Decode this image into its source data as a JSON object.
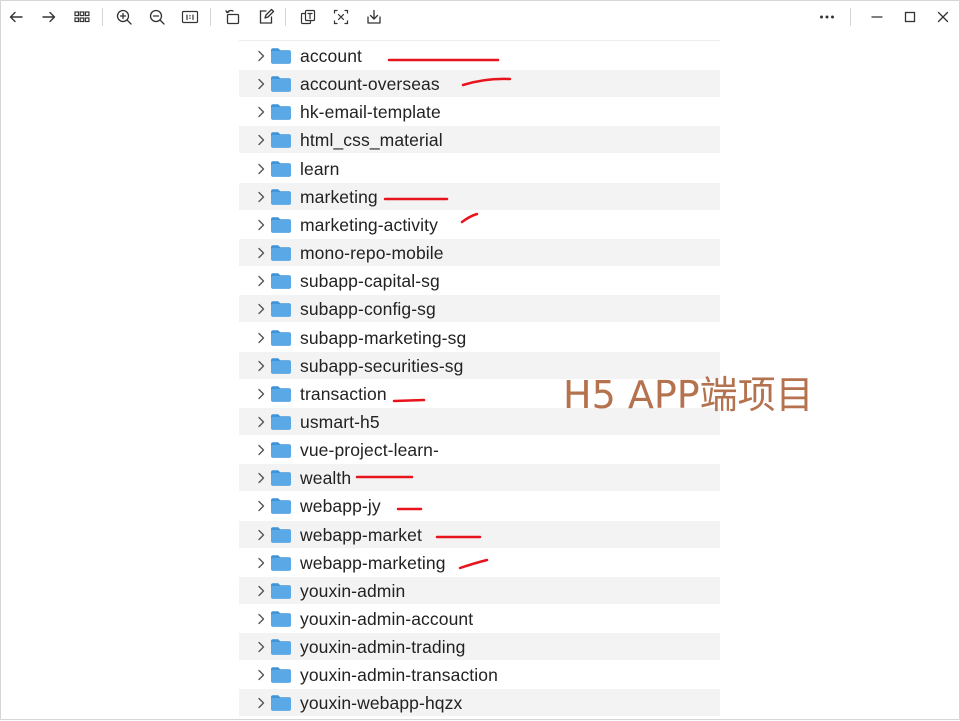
{
  "toolbar": {
    "buttons": [
      {
        "name": "back-arrow-icon"
      },
      {
        "name": "forward-arrow-icon"
      },
      {
        "name": "grid-view-icon"
      },
      {
        "name": "zoom-in-icon"
      },
      {
        "name": "zoom-out-icon"
      },
      {
        "name": "actual-size-icon"
      },
      {
        "name": "rotate-icon"
      },
      {
        "name": "edit-icon"
      },
      {
        "name": "ocr-icon"
      },
      {
        "name": "crop-icon"
      },
      {
        "name": "save-icon"
      },
      {
        "name": "more-icon"
      },
      {
        "name": "minimize-icon"
      },
      {
        "name": "maximize-icon"
      },
      {
        "name": "close-icon"
      }
    ]
  },
  "folders": [
    {
      "name": "account",
      "marked": true
    },
    {
      "name": "account-overseas",
      "marked": true
    },
    {
      "name": "hk-email-template",
      "marked": false
    },
    {
      "name": "html_css_material",
      "marked": false
    },
    {
      "name": "learn",
      "marked": false
    },
    {
      "name": "marketing",
      "marked": true
    },
    {
      "name": "marketing-activity",
      "marked": true
    },
    {
      "name": "mono-repo-mobile",
      "marked": false
    },
    {
      "name": "subapp-capital-sg",
      "marked": false
    },
    {
      "name": "subapp-config-sg",
      "marked": false
    },
    {
      "name": "subapp-marketing-sg",
      "marked": false
    },
    {
      "name": "subapp-securities-sg",
      "marked": false
    },
    {
      "name": "transaction",
      "marked": true
    },
    {
      "name": "usmart-h5",
      "marked": false
    },
    {
      "name": "vue-project-learn-",
      "marked": false
    },
    {
      "name": "wealth",
      "marked": true
    },
    {
      "name": "webapp-jy",
      "marked": true
    },
    {
      "name": "webapp-market",
      "marked": true
    },
    {
      "name": "webapp-marketing",
      "marked": true
    },
    {
      "name": "youxin-admin",
      "marked": false
    },
    {
      "name": "youxin-admin-account",
      "marked": false
    },
    {
      "name": "youxin-admin-trading",
      "marked": false
    },
    {
      "name": "youxin-admin-transaction",
      "marked": false
    },
    {
      "name": "youxin-webapp-hqzx",
      "marked": false
    }
  ],
  "annotation": {
    "text": "H5 APP端项目",
    "color": "#b5724f"
  },
  "colors": {
    "folder": "#5aa9e6",
    "folder_dark": "#3f93d6",
    "mark": "#e8141b",
    "row_alt": "#f3f3f3"
  }
}
